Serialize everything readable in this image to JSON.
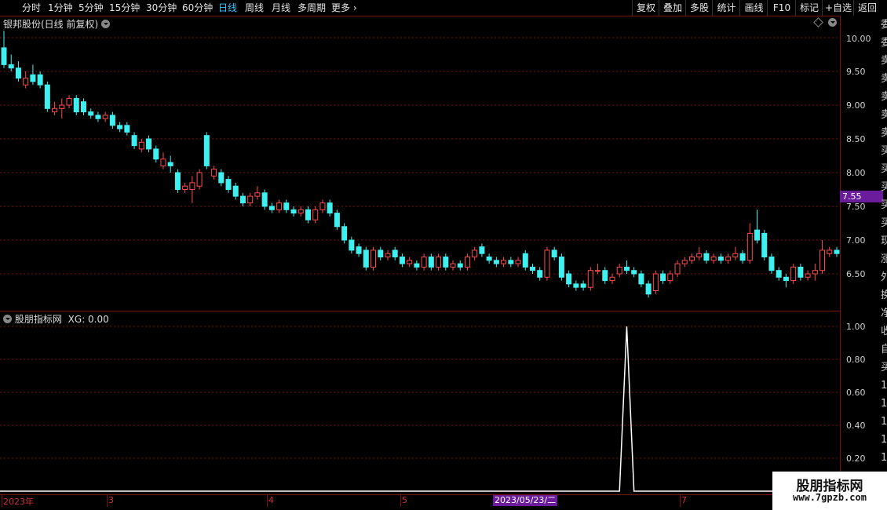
{
  "toolbar": {
    "left": [
      "分时",
      "1分钟",
      "5分钟",
      "15分钟",
      "30分钟",
      "60分钟",
      "日线",
      "周线",
      "月线",
      "多周期",
      "更多"
    ],
    "active": "日线",
    "right": [
      "复权",
      "叠加",
      "多股",
      "统计",
      "画线",
      "F10",
      "标记",
      "+自选",
      "返回"
    ]
  },
  "main_panel": {
    "title": "银邦股份(日线 前复权)",
    "last_price": "7.55",
    "y_labels": [
      "10.00",
      "9.50",
      "9.00",
      "8.50",
      "8.00",
      "7.50",
      "7.00",
      "6.50"
    ]
  },
  "indicator_panel": {
    "title": "股朋指标网",
    "value_text": "XG: 0.00",
    "y_labels": [
      "1.00",
      "0.80",
      "0.60",
      "0.40",
      "0.20"
    ]
  },
  "x_axis": {
    "ticks": [
      "2023年",
      "3",
      "4",
      "5",
      "7"
    ],
    "cursor_date": "2023/05/23/二"
  },
  "right_strip": [
    "委",
    "委",
    "卖",
    "卖",
    "卖",
    "卖",
    "卖",
    "买",
    "买",
    "买",
    "买",
    "买",
    "现",
    "涨",
    "外",
    "换",
    "净",
    "收",
    "自",
    "买",
    "1",
    "1",
    "1",
    "1",
    "1"
  ],
  "watermark": {
    "line1": "股朋指标网",
    "line2": "www.7gpzb.com"
  },
  "colors": {
    "up": "#ff4b4b",
    "down": "#3ef0f0",
    "grid": "#7a1010",
    "accent": "#6a1c9c"
  },
  "chart_data": [
    {
      "type": "candlestick",
      "title": "银邦股份(日线 前复权)",
      "ylim": [
        6.1,
        10.2
      ],
      "candles": [
        [
          9.85,
          9.6,
          10.1,
          9.55
        ],
        [
          9.6,
          9.55,
          9.75,
          9.5
        ],
        [
          9.55,
          9.4,
          9.65,
          9.35
        ],
        [
          9.3,
          9.4,
          9.5,
          9.25
        ],
        [
          9.45,
          9.35,
          9.6,
          9.3
        ],
        [
          9.45,
          9.3,
          9.5,
          9.25
        ],
        [
          9.3,
          8.95,
          9.35,
          8.9
        ],
        [
          8.9,
          8.95,
          9.05,
          8.85
        ],
        [
          8.95,
          9.0,
          9.1,
          8.8
        ],
        [
          9.0,
          9.1,
          9.15,
          8.95
        ],
        [
          9.1,
          8.9,
          9.15,
          8.85
        ],
        [
          9.05,
          8.9,
          9.1,
          8.85
        ],
        [
          8.9,
          8.85,
          8.95,
          8.8
        ],
        [
          8.85,
          8.8,
          8.9,
          8.75
        ],
        [
          8.8,
          8.85,
          8.9,
          8.75
        ],
        [
          8.85,
          8.7,
          8.9,
          8.65
        ],
        [
          8.7,
          8.65,
          8.75,
          8.6
        ],
        [
          8.7,
          8.6,
          8.75,
          8.55
        ],
        [
          8.55,
          8.4,
          8.6,
          8.35
        ],
        [
          8.35,
          8.45,
          8.5,
          8.3
        ],
        [
          8.5,
          8.35,
          8.55,
          8.3
        ],
        [
          8.35,
          8.2,
          8.4,
          8.15
        ],
        [
          8.1,
          8.2,
          8.3,
          8.05
        ],
        [
          8.15,
          8.1,
          8.25,
          8.0
        ],
        [
          8.0,
          7.75,
          8.05,
          7.7
        ],
        [
          7.75,
          7.8,
          7.85,
          7.7
        ],
        [
          7.75,
          7.85,
          7.95,
          7.55
        ],
        [
          7.8,
          8.0,
          8.05,
          7.75
        ],
        [
          8.55,
          8.1,
          8.6,
          8.05
        ],
        [
          7.95,
          8.05,
          8.1,
          7.9
        ],
        [
          8.0,
          7.85,
          8.05,
          7.8
        ],
        [
          7.9,
          7.75,
          7.95,
          7.7
        ],
        [
          7.8,
          7.65,
          7.85,
          7.6
        ],
        [
          7.65,
          7.55,
          7.7,
          7.5
        ],
        [
          7.55,
          7.65,
          7.7,
          7.5
        ],
        [
          7.65,
          7.7,
          7.8,
          7.6
        ],
        [
          7.7,
          7.5,
          7.75,
          7.45
        ],
        [
          7.5,
          7.45,
          7.55,
          7.4
        ],
        [
          7.45,
          7.55,
          7.6,
          7.4
        ],
        [
          7.55,
          7.45,
          7.6,
          7.4
        ],
        [
          7.45,
          7.4,
          7.5,
          7.35
        ],
        [
          7.4,
          7.45,
          7.5,
          7.35
        ],
        [
          7.45,
          7.3,
          7.5,
          7.25
        ],
        [
          7.3,
          7.45,
          7.5,
          7.25
        ],
        [
          7.45,
          7.55,
          7.6,
          7.4
        ],
        [
          7.55,
          7.4,
          7.6,
          7.35
        ],
        [
          7.4,
          7.2,
          7.45,
          7.15
        ],
        [
          7.2,
          7.0,
          7.25,
          6.95
        ],
        [
          7.0,
          6.85,
          7.05,
          6.8
        ],
        [
          6.9,
          6.8,
          6.95,
          6.75
        ],
        [
          6.85,
          6.6,
          6.9,
          6.55
        ],
        [
          6.6,
          6.85,
          6.9,
          6.55
        ],
        [
          6.85,
          6.75,
          6.9,
          6.7
        ],
        [
          6.75,
          6.8,
          6.85,
          6.7
        ],
        [
          6.85,
          6.75,
          6.9,
          6.7
        ],
        [
          6.75,
          6.65,
          6.8,
          6.6
        ],
        [
          6.65,
          6.7,
          6.75,
          6.6
        ],
        [
          6.65,
          6.6,
          6.7,
          6.55
        ],
        [
          6.6,
          6.75,
          6.8,
          6.55
        ],
        [
          6.75,
          6.6,
          6.8,
          6.55
        ],
        [
          6.6,
          6.75,
          6.8,
          6.55
        ],
        [
          6.75,
          6.6,
          6.8,
          6.55
        ],
        [
          6.6,
          6.65,
          6.7,
          6.55
        ],
        [
          6.65,
          6.6,
          6.7,
          6.55
        ],
        [
          6.6,
          6.75,
          6.8,
          6.55
        ],
        [
          6.75,
          6.85,
          6.9,
          6.7
        ],
        [
          6.9,
          6.8,
          6.95,
          6.75
        ],
        [
          6.75,
          6.7,
          6.8,
          6.65
        ],
        [
          6.7,
          6.65,
          6.75,
          6.6
        ],
        [
          6.65,
          6.7,
          6.75,
          6.6
        ],
        [
          6.7,
          6.65,
          6.75,
          6.6
        ],
        [
          6.65,
          6.7,
          6.75,
          6.6
        ],
        [
          6.8,
          6.6,
          6.85,
          6.55
        ],
        [
          6.6,
          6.55,
          6.65,
          6.5
        ],
        [
          6.55,
          6.45,
          6.6,
          6.4
        ],
        [
          6.45,
          6.85,
          6.9,
          6.4
        ],
        [
          6.85,
          6.75,
          6.9,
          6.7
        ],
        [
          6.75,
          6.45,
          6.8,
          6.4
        ],
        [
          6.5,
          6.35,
          6.55,
          6.3
        ],
        [
          6.35,
          6.3,
          6.4,
          6.25
        ],
        [
          6.35,
          6.3,
          6.4,
          6.25
        ],
        [
          6.3,
          6.55,
          6.6,
          6.25
        ],
        [
          6.55,
          6.55,
          6.65,
          6.5
        ],
        [
          6.55,
          6.4,
          6.6,
          6.35
        ],
        [
          6.4,
          6.45,
          6.5,
          6.35
        ],
        [
          6.5,
          6.6,
          6.65,
          6.45
        ],
        [
          6.6,
          6.55,
          6.7,
          6.5
        ],
        [
          6.55,
          6.5,
          6.6,
          6.45
        ],
        [
          6.5,
          6.35,
          6.55,
          6.3
        ],
        [
          6.35,
          6.2,
          6.4,
          6.15
        ],
        [
          6.25,
          6.5,
          6.55,
          6.2
        ],
        [
          6.5,
          6.4,
          6.55,
          6.35
        ],
        [
          6.4,
          6.5,
          6.55,
          6.35
        ],
        [
          6.5,
          6.65,
          6.7,
          6.45
        ],
        [
          6.65,
          6.7,
          6.75,
          6.6
        ],
        [
          6.7,
          6.75,
          6.8,
          6.65
        ],
        [
          6.75,
          6.8,
          6.9,
          6.7
        ],
        [
          6.8,
          6.7,
          6.85,
          6.65
        ],
        [
          6.7,
          6.75,
          6.8,
          6.65
        ],
        [
          6.75,
          6.7,
          6.8,
          6.65
        ],
        [
          6.7,
          6.75,
          6.8,
          6.65
        ],
        [
          6.75,
          6.8,
          6.9,
          6.7
        ],
        [
          6.8,
          6.7,
          6.85,
          6.65
        ],
        [
          6.7,
          7.1,
          7.25,
          6.65
        ],
        [
          7.15,
          7.0,
          7.45,
          6.95
        ],
        [
          7.1,
          6.75,
          7.15,
          6.7
        ],
        [
          6.75,
          6.55,
          6.8,
          6.5
        ],
        [
          6.55,
          6.45,
          6.6,
          6.4
        ],
        [
          6.45,
          6.4,
          6.5,
          6.3
        ],
        [
          6.4,
          6.6,
          6.65,
          6.35
        ],
        [
          6.6,
          6.45,
          6.65,
          6.4
        ],
        [
          6.45,
          6.5,
          6.55,
          6.4
        ],
        [
          6.5,
          6.55,
          6.65,
          6.4
        ],
        [
          6.55,
          6.85,
          7.0,
          6.5
        ],
        [
          6.8,
          6.85,
          6.9,
          6.75
        ],
        [
          6.85,
          6.8,
          6.9,
          6.75
        ]
      ]
    },
    {
      "type": "line",
      "series": [
        {
          "name": "XG",
          "values_note": "",
          "spike_index": 86,
          "values_spike": 1.0
        }
      ],
      "ylim": [
        0,
        1.05
      ]
    }
  ]
}
